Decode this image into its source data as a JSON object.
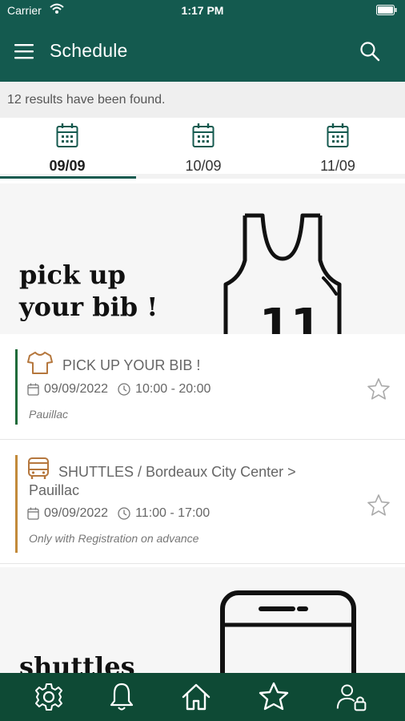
{
  "status": {
    "carrier": "Carrier",
    "time": "1:17 PM"
  },
  "header": {
    "title": "Schedule"
  },
  "results_text": "12 results have been found.",
  "tabs": [
    {
      "label": "09/09",
      "active": true
    },
    {
      "label": "10/09",
      "active": false
    },
    {
      "label": "11/09",
      "active": false
    }
  ],
  "banners": [
    {
      "line1": "pick up",
      "line2": "your bib !",
      "jersey_number": "11"
    },
    {
      "line1": "shuttles"
    }
  ],
  "events": [
    {
      "title": "PICK UP YOUR BIB !",
      "date": "09/09/2022",
      "time": "10:00 - 20:00",
      "note": "Pauillac",
      "color": "#1f6b3a",
      "icon": "tshirt-icon",
      "icon_color": "#b5773d"
    },
    {
      "title_line1": "SHUTTLES / Bordeaux City Center >",
      "title_line2": "Pauillac",
      "date": "09/09/2022",
      "time": "11:00 - 17:00",
      "note": "Only with Registration on advance",
      "color": "#c28a3a",
      "icon": "bus-icon",
      "icon_color": "#b5773d"
    }
  ],
  "theme": {
    "primary": "#145a4f",
    "bottom_nav": "#0e4a35"
  },
  "bottom_nav": [
    "gear-icon",
    "bell-icon",
    "home-icon",
    "star-icon",
    "user-lock-icon"
  ]
}
